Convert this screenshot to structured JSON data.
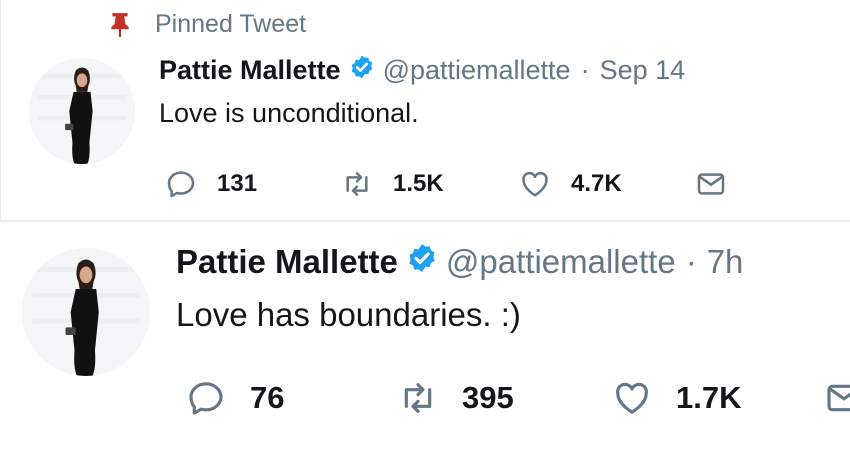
{
  "tweets": [
    {
      "pinned_label": "Pinned Tweet",
      "name": "Pattie Mallette",
      "handle": "@pattiemallette",
      "separator": "·",
      "time": "Sep 14",
      "text": "Love is unconditional.",
      "replies": "131",
      "retweets": "1.5K",
      "likes": "4.7K"
    },
    {
      "name": "Pattie Mallette",
      "handle": "@pattiemallette",
      "separator": "·",
      "time": "7h",
      "text": "Love has boundaries. :)",
      "replies": "76",
      "retweets": "395",
      "likes": "1.7K"
    }
  ],
  "colors": {
    "verified": "#1da1f2",
    "pin": "#e0245e",
    "muted": "#657786",
    "text": "#14171a"
  },
  "icons": [
    "pin-icon",
    "verified-icon",
    "reply-icon",
    "retweet-icon",
    "like-icon",
    "direct-message-icon"
  ]
}
